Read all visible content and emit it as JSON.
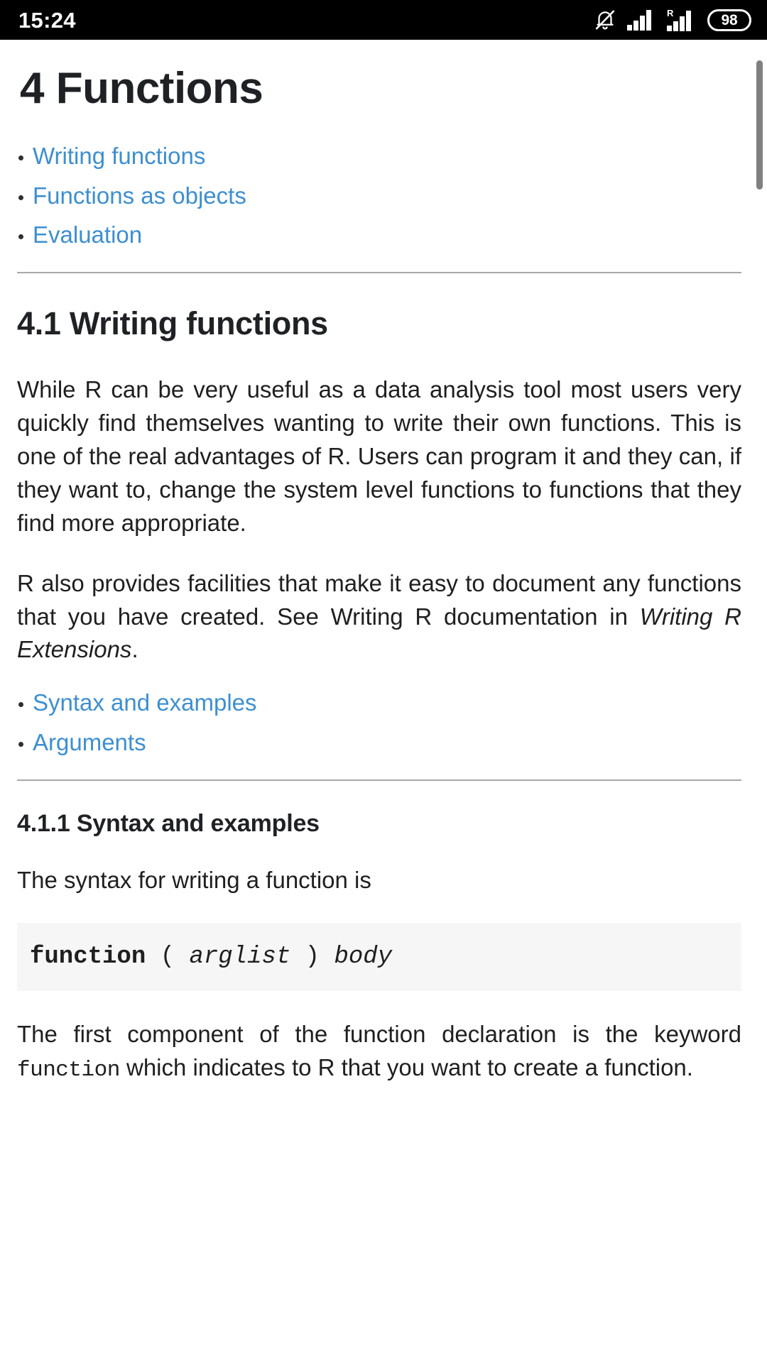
{
  "statusbar": {
    "time": "15:24",
    "icons": [
      {
        "name": "notifications-muted-icon",
        "label": "bell-slash"
      },
      {
        "name": "signal-bars-icon",
        "label": "signal"
      },
      {
        "name": "roaming-signal-icon",
        "label": "R signal"
      }
    ],
    "roaming_label": "R",
    "battery_level": "98"
  },
  "scrollbar": {
    "thumb_color": "#808080"
  },
  "colors": {
    "link": "#3d8fd0",
    "heading": "#1f2124",
    "body": "#1f1f1f",
    "code_background": "#f6f6f6",
    "rule": "#a8a8a8",
    "statusbar_background": "#000000"
  },
  "document": {
    "title": "4 Functions",
    "chapter_toc": [
      {
        "label": "Writing functions"
      },
      {
        "label": "Functions as objects"
      },
      {
        "label": "Evaluation"
      }
    ],
    "section": {
      "heading": "4.1 Writing functions",
      "paragraphs": [
        "While R can be very useful as a data analysis tool most users very quickly find themselves wanting to write their own functions. This is one of the real advantages of R. Users can program it and they can, if they want to, change the system level functions to functions that they find more appropriate.",
        {
          "parts": [
            {
              "text": "R also provides facilities that make it easy to document any functions that you have created. See Writing R documentation in ",
              "style": "normal"
            },
            {
              "text": "Writing R Extensions",
              "style": "italic"
            },
            {
              "text": ".",
              "style": "normal"
            }
          ]
        }
      ],
      "section_toc": [
        {
          "label": "Syntax and examples"
        },
        {
          "label": "Arguments"
        }
      ]
    },
    "subsection": {
      "heading": "4.1.1 Syntax and examples",
      "intro": "The syntax for writing a function is",
      "codeblock": {
        "tokens": [
          {
            "text": "function",
            "style": "bold"
          },
          {
            "text": " ( ",
            "style": "plain"
          },
          {
            "text": "arglist",
            "style": "italic"
          },
          {
            "text": " ) ",
            "style": "plain"
          },
          {
            "text": "body",
            "style": "italic"
          }
        ],
        "plain_text": "function ( arglist ) body"
      },
      "closing": {
        "before_code": "The first component of the function declaration is the keyword ",
        "code": "function",
        "after_code": " which indicates to R that you want to create a function."
      }
    }
  }
}
